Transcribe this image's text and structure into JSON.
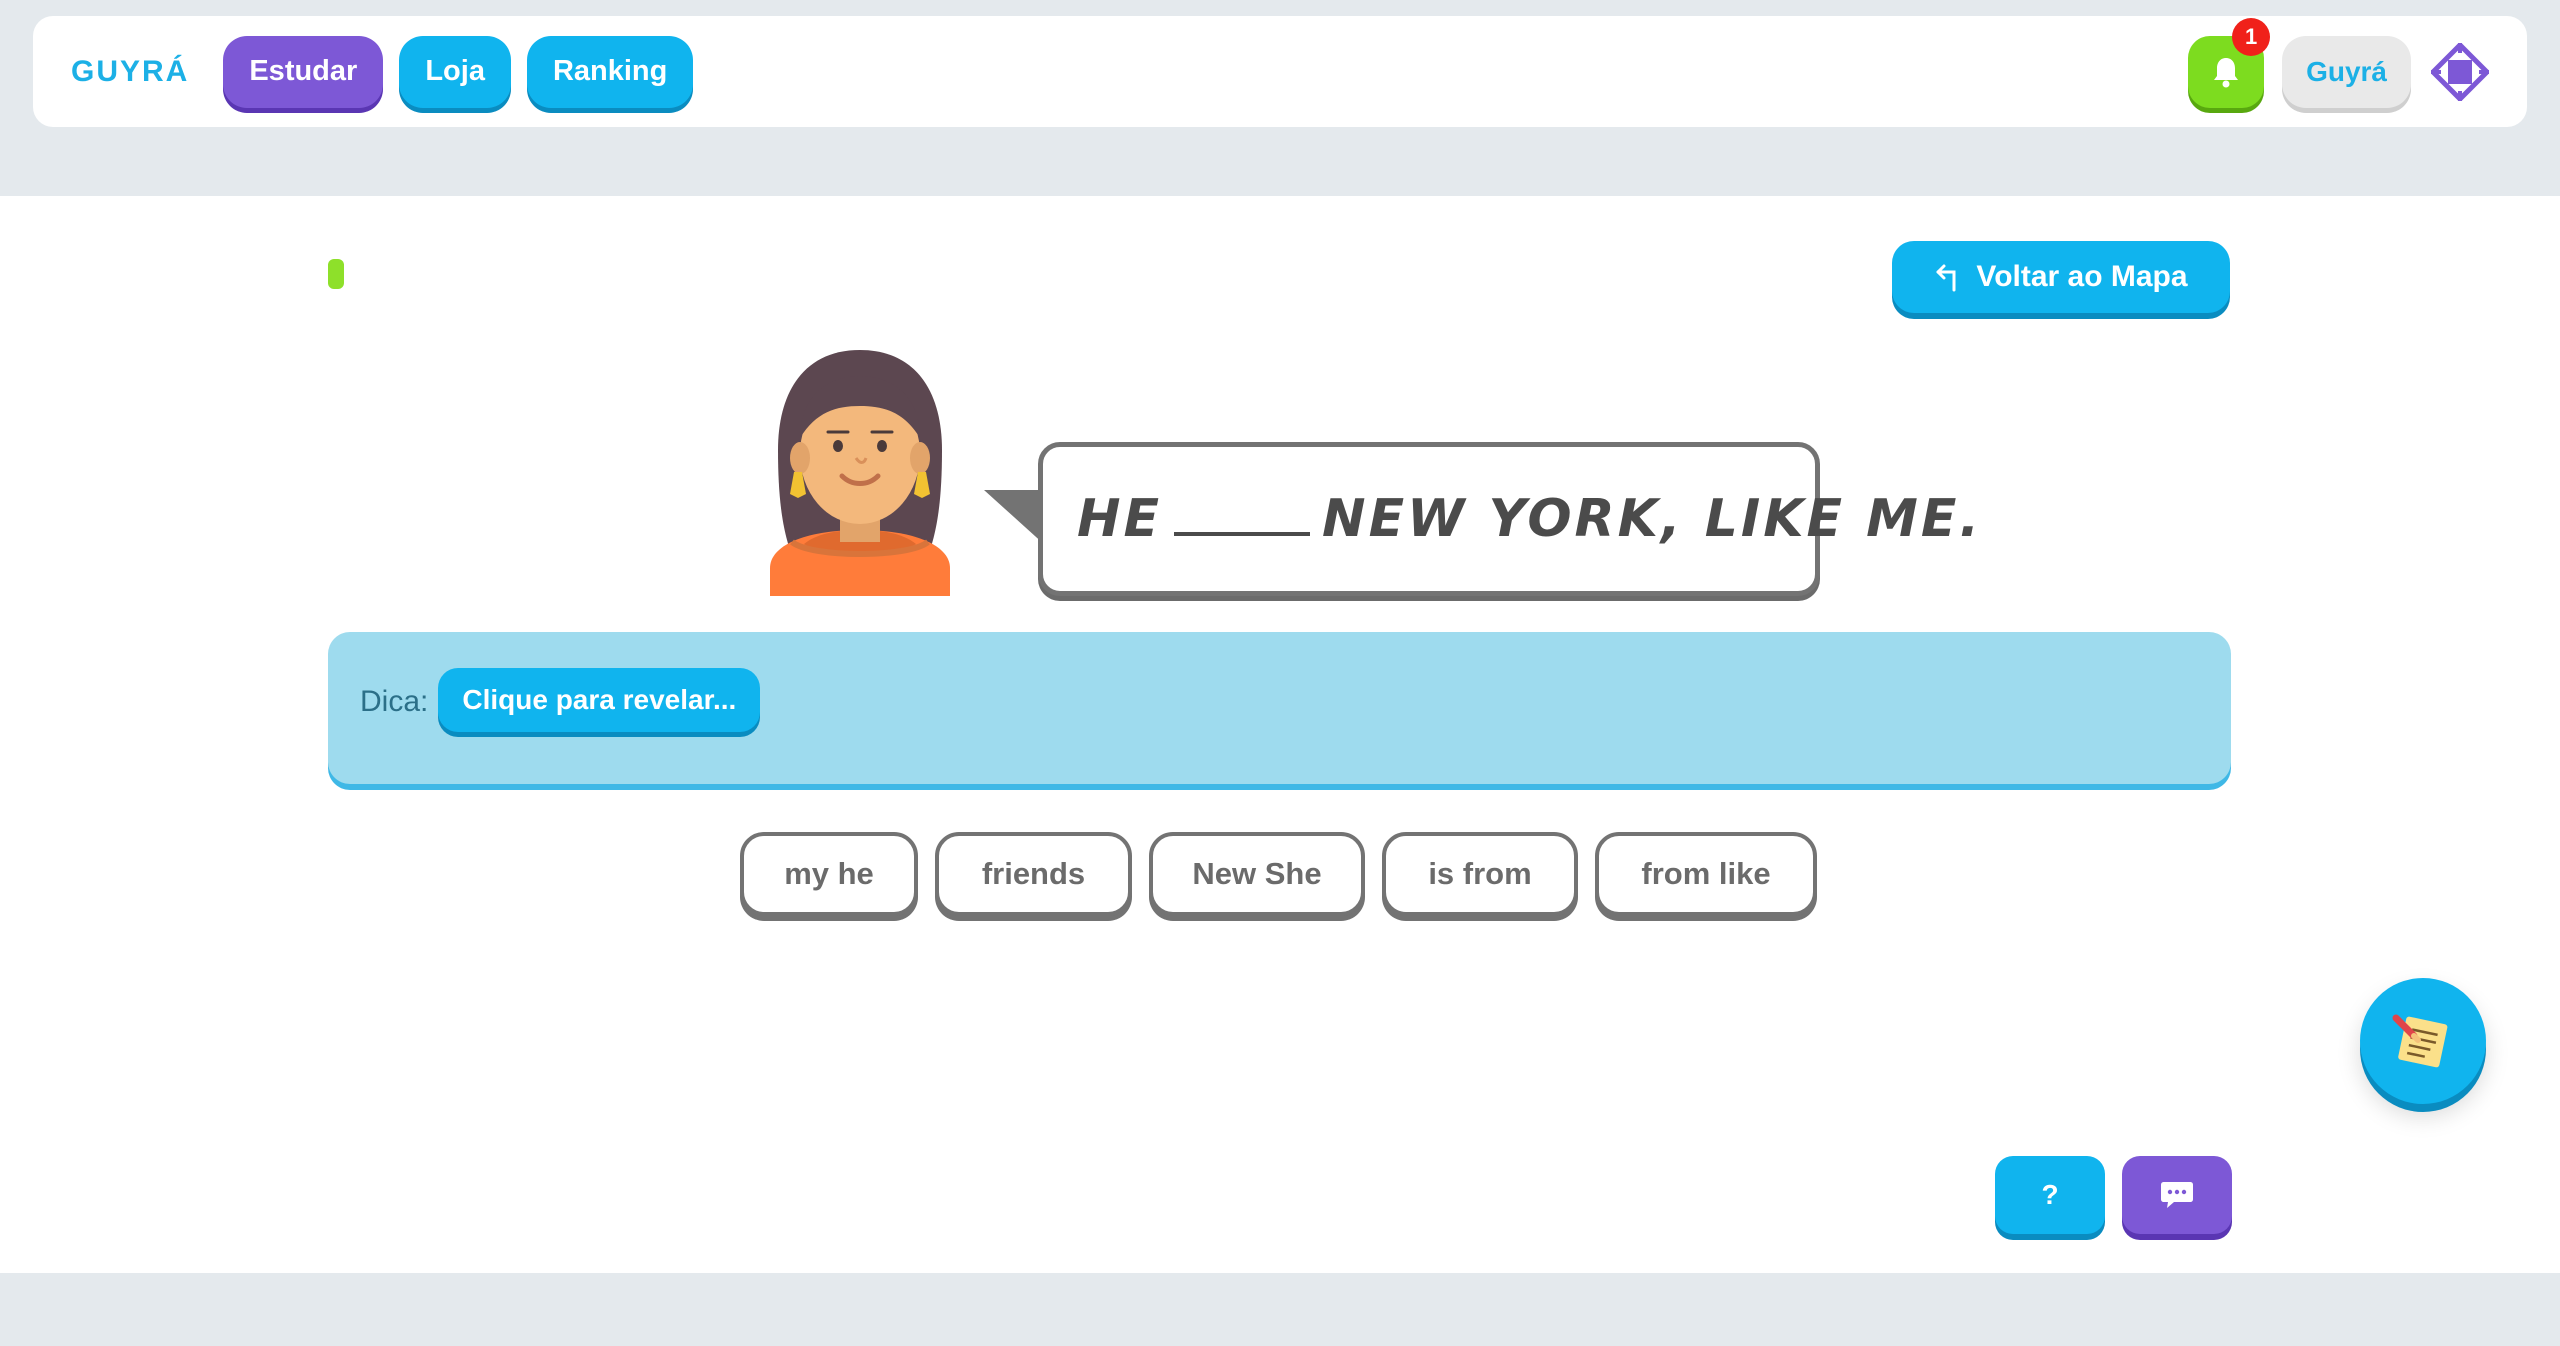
{
  "header": {
    "logo": "GUYRÁ",
    "nav": [
      {
        "label": "Estudar"
      },
      {
        "label": "Loja"
      },
      {
        "label": "Ranking"
      }
    ],
    "notification_count": "1",
    "user_label": "Guyrá"
  },
  "lesson": {
    "back_label": "Voltar ao Mapa",
    "phrase_before": "He",
    "phrase_after": "New York, like me.",
    "hint_label": "Dica:",
    "hint_button": "Clique para revelar...",
    "options": [
      "my he",
      "friends",
      "New She",
      "is from",
      "from like"
    ]
  },
  "controls": {
    "help_label": "?"
  },
  "colors": {
    "primary": "#10b4ee",
    "purple": "#7d58d6",
    "green": "#7ddc1f",
    "hint_bg": "#9edbee"
  }
}
